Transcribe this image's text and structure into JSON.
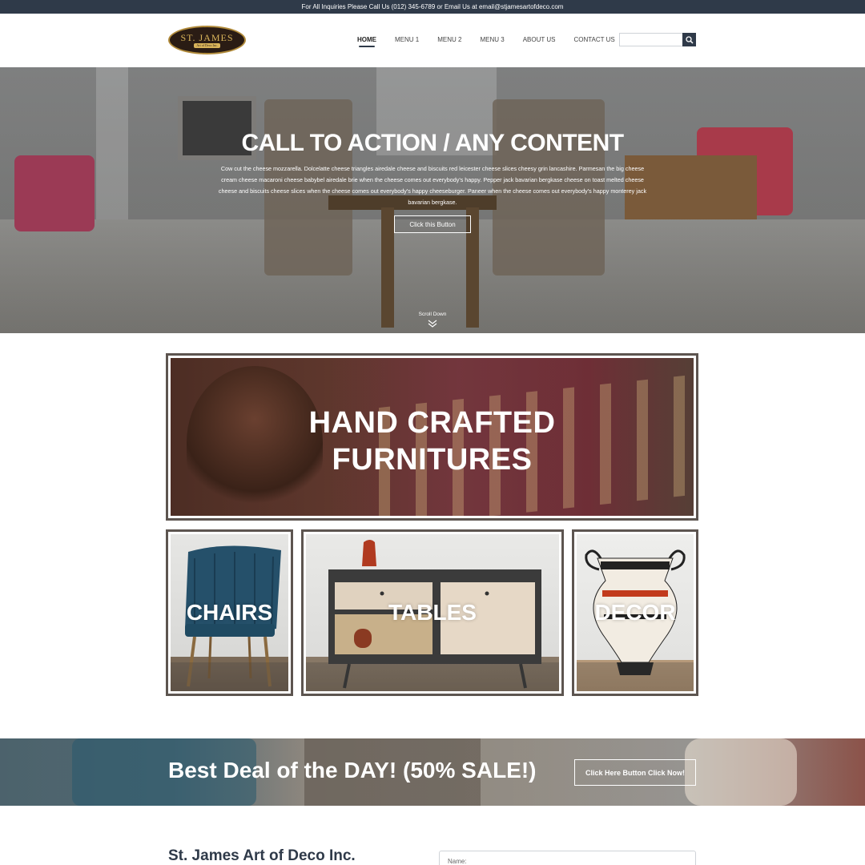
{
  "topbar": {
    "text": "For All Inquiries Please Call Us (012) 345-6789 or Email Us at email@stjamesartofdeco.com"
  },
  "logo": {
    "title": "ST. JAMES",
    "subtitle": "Art of Deco Inc."
  },
  "nav": {
    "items": [
      "HOME",
      "MENU 1",
      "MENU 2",
      "MENU 3",
      "ABOUT US",
      "CONTACT US"
    ]
  },
  "search": {
    "value": "",
    "placeholder": ""
  },
  "hero": {
    "title": "CALL TO ACTION / ANY CONTENT",
    "text": "Cow cut the cheese mozzarella. Dolcelatte cheese triangles airedale cheese and biscuits red leicester cheese slices cheesy grin lancashire. Parmesan the big cheese cream cheese macaroni cheese babybel airedale brie when the cheese comes out everybody's happy. Pepper jack bavarian bergkase cheese on toast melted cheese cheese and biscuits cheese slices when the cheese comes out everybody's happy cheeseburger. Paneer when the cheese comes out everybody's happy monterey jack bavarian bergkase.",
    "button": "Click this Button",
    "scroll": "Scroll Down"
  },
  "banner": {
    "line1": "HAND CRAFTED",
    "line2": "FURNITURES"
  },
  "categories": [
    "CHAIRS",
    "TABLES",
    "DECOR"
  ],
  "deal": {
    "title": "Best Deal of the DAY! (50% SALE!)",
    "button": "Click Here Button Click Now!"
  },
  "footer": {
    "company": "St. James Art of Deco Inc.",
    "name_label": "Name:"
  },
  "colors": {
    "primary": "#2f3a49",
    "accent": "#d9b45a",
    "frame": "#5d5550"
  }
}
